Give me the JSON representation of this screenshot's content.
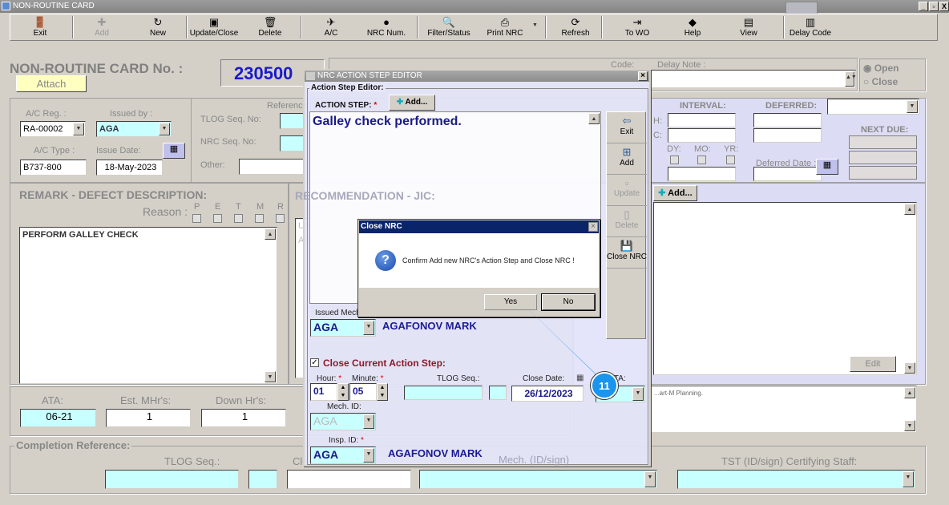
{
  "window": {
    "title": "NON-ROUTINE CARD",
    "controls": [
      "_",
      "▫",
      "X"
    ]
  },
  "toolbar": [
    {
      "label": "Exit",
      "icon": "exit-icon"
    },
    {
      "label": "Add",
      "icon": "plus-icon",
      "disabled": true
    },
    {
      "label": "New",
      "icon": "new-icon"
    },
    {
      "label": "Update/Close",
      "icon": "save-icon"
    },
    {
      "label": "Delete",
      "icon": "trash-icon"
    },
    {
      "label": "A/C",
      "icon": "aircraft-icon"
    },
    {
      "label": "NRC Num.",
      "icon": "nrc-num-icon"
    },
    {
      "label": "Filter/Status",
      "icon": "magnifier-icon"
    },
    {
      "label": "Print NRC",
      "icon": "printer-icon"
    },
    {
      "label": "Refresh",
      "icon": "refresh-icon"
    },
    {
      "label": "To WO",
      "icon": "to-wo-icon"
    },
    {
      "label": "Help",
      "icon": "help-icon"
    },
    {
      "label": "View",
      "icon": "view-icon"
    },
    {
      "label": "Delay Code",
      "icon": "delay-code-icon"
    }
  ],
  "header": {
    "title": "NON-ROUTINE CARD No. :",
    "attach": "Attach",
    "card_no": "230500",
    "delay_note_label": "Delay Note :",
    "code_label": "Code:",
    "status_open": "Open",
    "status_close": "Close",
    "status_selected": "Open"
  },
  "aircraft": {
    "reg_label": "A/C Reg. :",
    "reg": "RA-00002",
    "issued_by_label": "Issued by :",
    "issued_by": "AGA",
    "type_label": "A/C Type :",
    "type": "B737-800",
    "issue_date_label": "Issue Date:",
    "issue_date": "18-May-2023",
    "reference_label": "Reference",
    "tlog_label": "TLOG Seq. No:",
    "nrc_seq_label": "NRC Seq. No:",
    "other_label": "Other:"
  },
  "interval": {
    "interval_label": "INTERVAL:",
    "deferred_label": "DEFERRED:",
    "next_due_label": "NEXT DUE:",
    "dy": "DY:",
    "mo": "MO:",
    "yr": "YR:",
    "deferred_date_label": "Deferred Date :",
    "h": "H:",
    "c": "C:"
  },
  "remark": {
    "title": "REMARK - DEFECT DESCRIPTION:",
    "reason_label": "Reason :",
    "reasons": [
      "P",
      "E",
      "T",
      "M",
      "R"
    ],
    "text": "PERFORM GALLEY CHECK"
  },
  "recommendation": {
    "title": "RECOMMENDATION - JIC:",
    "text": "USE AIRPORT"
  },
  "action": {
    "add": "Add...",
    "edit": "Edit",
    "note": "...art-M Planning."
  },
  "stats": {
    "ata_label": "ATA:",
    "ata": "06-21",
    "mhrs_label": "Est. MHr's:",
    "mhrs": "1",
    "down_label": "Down Hr's:",
    "down": "1"
  },
  "completion": {
    "title": "Completion Reference:",
    "tlog_label": "TLOG Seq.:",
    "close_date_label": "Close Date",
    "mech_label": "Mech. (ID/sign)",
    "tst_label": "TST (ID/sign) Certifying Staff:"
  },
  "editor": {
    "title": "NRC ACTION STEP EDITOR",
    "group": "Action Step Editor:",
    "step_label": "ACTION STEP:",
    "add": "Add...",
    "step_text": "Galley check performed.",
    "side_buttons": [
      {
        "label": "Exit",
        "icon": "exit-door-icon"
      },
      {
        "label": "Add",
        "icon": "add-icon"
      },
      {
        "label": "Update",
        "icon": "update-icon",
        "disabled": true
      },
      {
        "label": "Delete",
        "icon": "delete-icon",
        "disabled": true
      },
      {
        "label": "Close NRC",
        "icon": "floppy-icon"
      }
    ],
    "issued_mech_label": "Issued Mech",
    "issued_mech": "AGA",
    "issued_mech_name": "AGAFONOV MARK",
    "close_step_label": "Close Current Action Step:",
    "close_step_checked": true,
    "hour_label": "Hour:",
    "hour": "01",
    "minute_label": "Minute:",
    "minute": "05",
    "tlog_label": "TLOG Seq.:",
    "close_date_label": "Close Date:",
    "close_date": "26/12/2023",
    "ata_label": "ATA:",
    "mech_label": "Mech. ID:",
    "mech": "AGA",
    "insp_label": "Insp. ID:",
    "insp": "AGA",
    "insp_name": "AGAFONOV MARK"
  },
  "confirm": {
    "title": "Close NRC",
    "message": "Confirm Add new NRC's Action Step and Close NRC !",
    "yes": "Yes",
    "no": "No"
  },
  "callout": {
    "step": "11",
    "color": "#1a94ec"
  }
}
